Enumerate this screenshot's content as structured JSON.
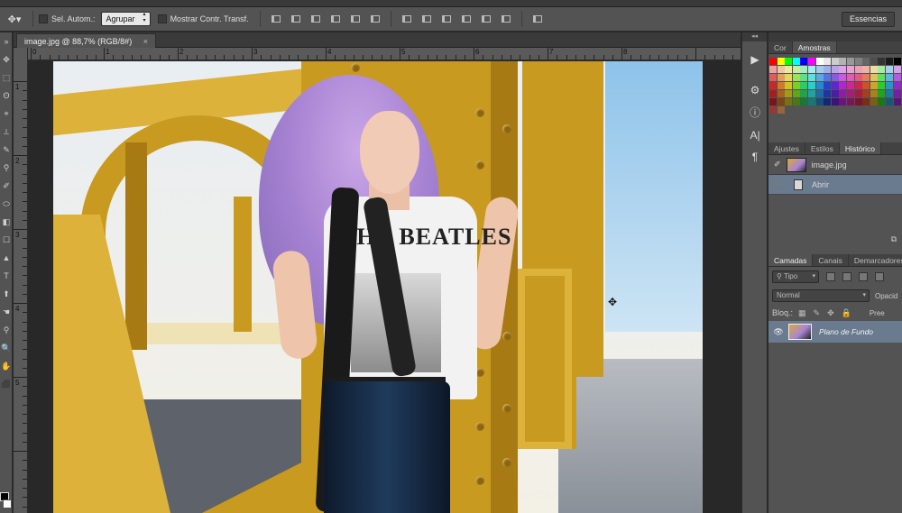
{
  "options_bar": {
    "tool_icon": "move-tool-icon",
    "auto_select_label": "Sel. Autom.:",
    "auto_select_value": "Agrupar",
    "transform_controls_label": "Mostrar Contr. Transf.",
    "workspace_button": "Essencias"
  },
  "document": {
    "tab_title": "image.jpg @ 88,7% (RGB/8#)",
    "tab_close": "×",
    "shirt_text": "THE BEATLES",
    "ruler_h_numbers": [
      "0",
      "1",
      "2",
      "3",
      "4",
      "5",
      "6",
      "7",
      "8"
    ],
    "ruler_v_numbers": [
      "1",
      "2",
      "3",
      "4",
      "5"
    ]
  },
  "tools": [
    "✥",
    "⬚",
    "ʘ",
    "⌖",
    "⟂",
    "✎",
    "⚲",
    "✐",
    "⬭",
    "◧",
    "☐",
    "▲",
    "T",
    "⬆",
    "☚",
    "⚲",
    "🔍",
    "✋",
    "⬛"
  ],
  "colors": {
    "foreground": "#000000",
    "background": "#ffffff",
    "accent_selection": "#6a7a8f"
  },
  "swatches_panel": {
    "tabs": [
      "Cor",
      "Amostras"
    ],
    "active_tab": "Amostras"
  },
  "history_panel": {
    "tabs": [
      "Ajustes",
      "Estilos",
      "Histórico"
    ],
    "active_tab": "Histórico",
    "snapshot_name": "image.jpg",
    "states": [
      "Abrir"
    ]
  },
  "layers_panel": {
    "tabs": [
      "Camadas",
      "Canais",
      "Demarcadores"
    ],
    "active_tab": "Camadas",
    "filter_label": "Tipo",
    "blend_mode": "Normal",
    "opacity_label": "Opacid",
    "lock_label": "Bloq.:",
    "fill_label": "Pree",
    "layers": [
      {
        "name": "Plano de Fundo",
        "visible": true
      }
    ]
  }
}
